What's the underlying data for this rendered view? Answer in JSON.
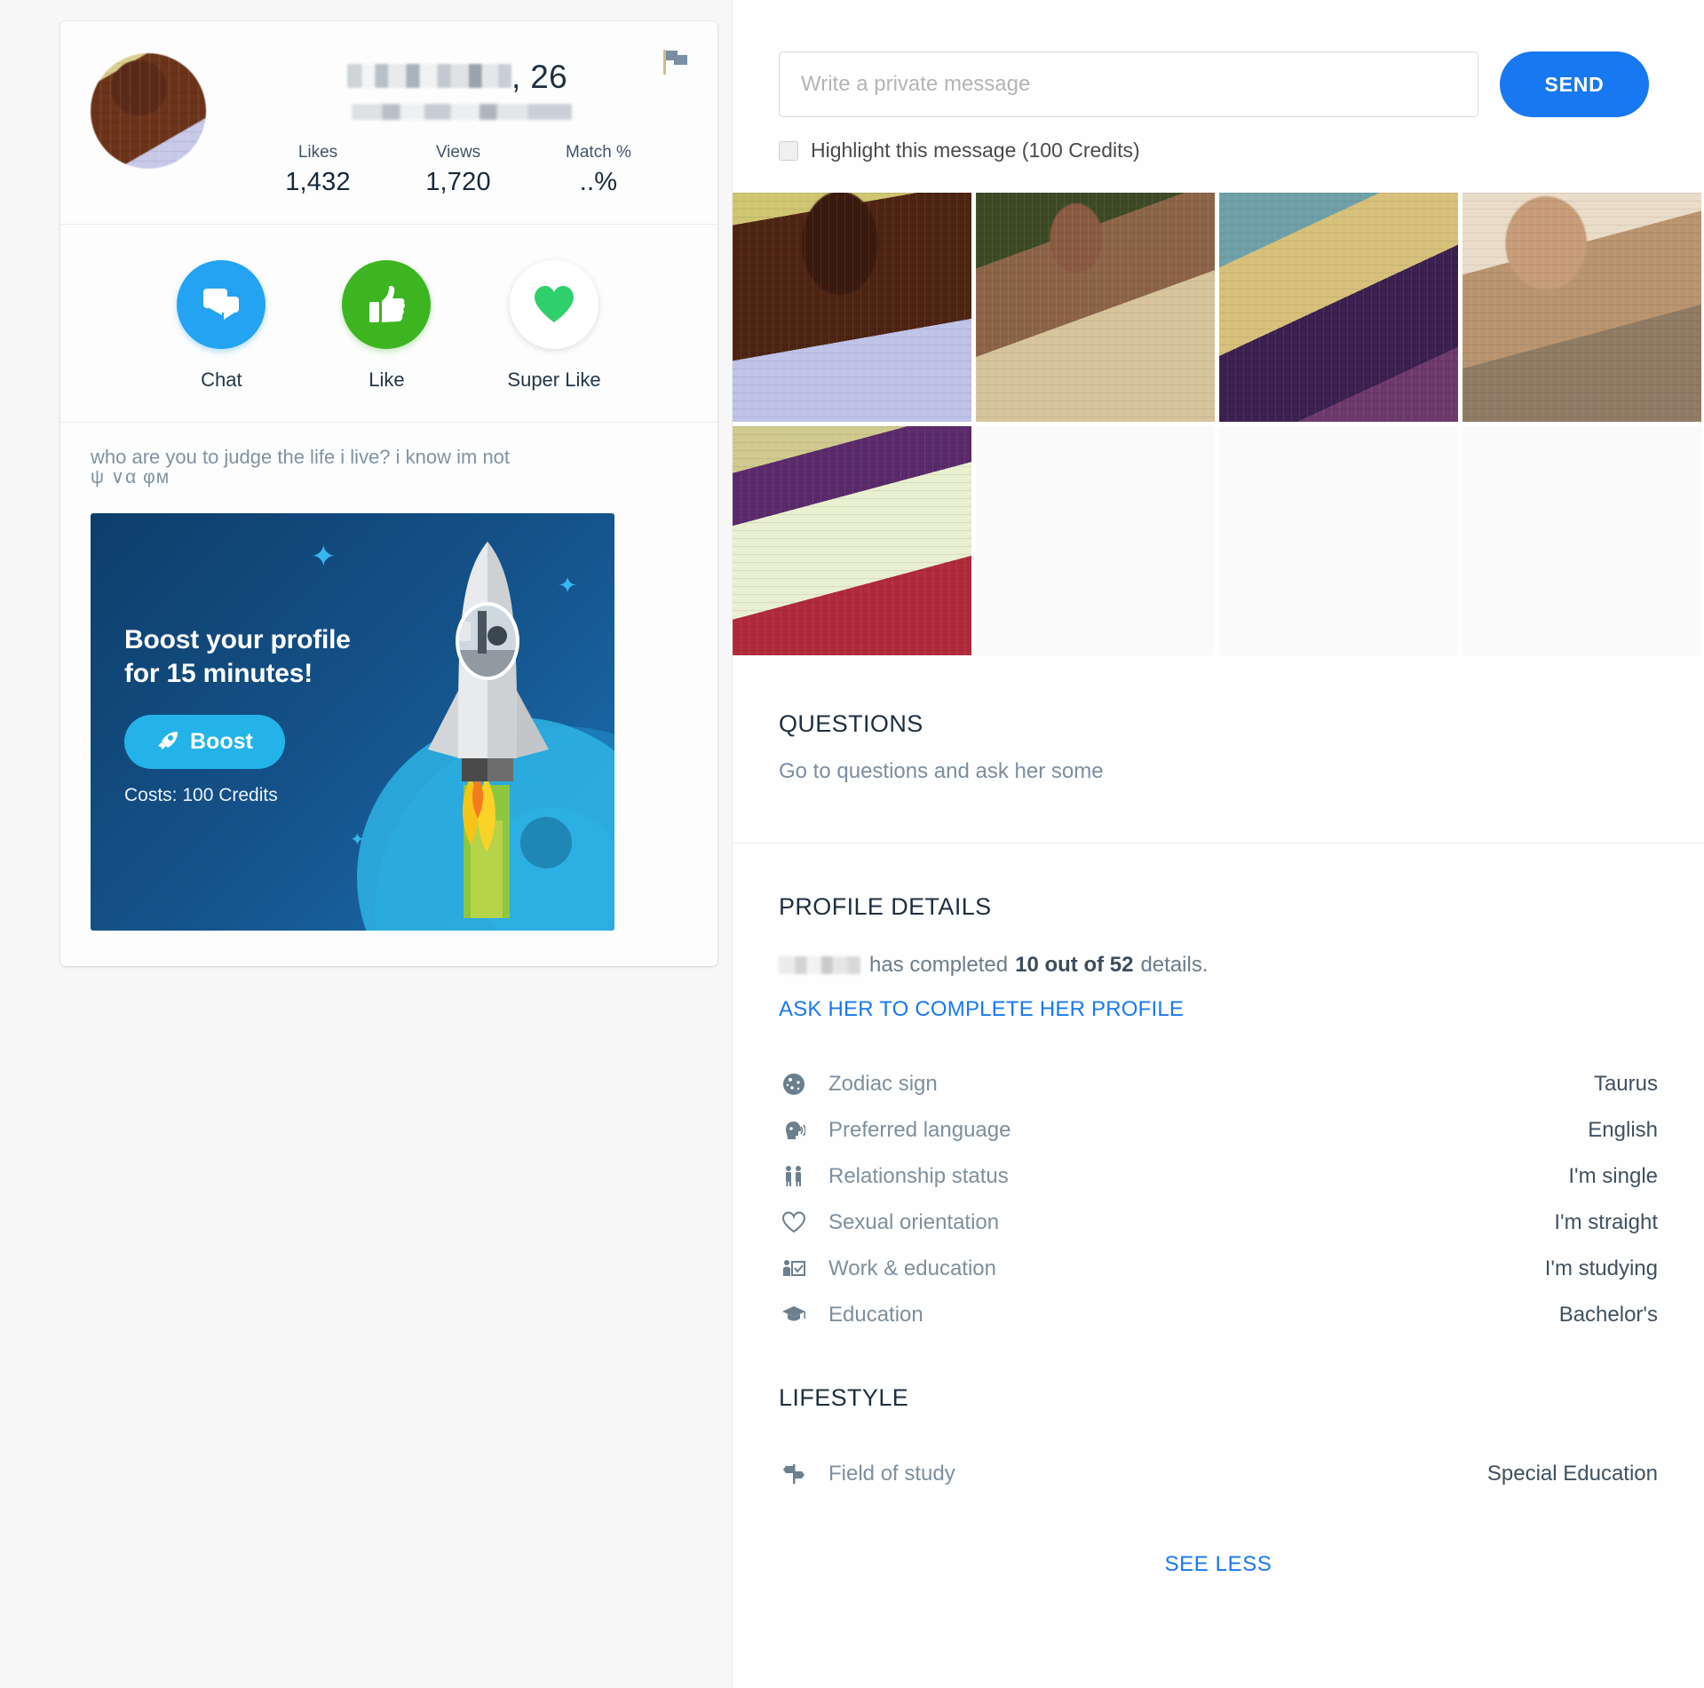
{
  "profile": {
    "name_redacted": true,
    "age": ", 26",
    "flag_icon": "flag-icon",
    "stats": [
      {
        "label": "Likes",
        "value": "1,432"
      },
      {
        "label": "Views",
        "value": "1,720"
      },
      {
        "label": "Match %",
        "value": "..%"
      }
    ],
    "actions": [
      {
        "label": "Chat",
        "icon": "chat-bubbles-icon",
        "color": "#23a3f2"
      },
      {
        "label": "Like",
        "icon": "thumbs-up-icon",
        "color": "#3cb521"
      },
      {
        "label": "Super Like",
        "icon": "heart-icon",
        "color": "#2fd06b"
      }
    ],
    "bio": "who are you to judge the life i live? i know im not",
    "bio_glyphs": "ψ ∨α φм"
  },
  "boost": {
    "title": "Boost your profile for 15 minutes!",
    "button_label": "Boost",
    "button_icon": "rocket-icon",
    "cost": "Costs: 100 Credits"
  },
  "message": {
    "placeholder": "Write a private message",
    "value": "",
    "send_label": "SEND",
    "highlight_label": "Highlight this message (100 Credits)",
    "highlight_checked": false
  },
  "gallery": {
    "photos": [
      {
        "name": "photo-1",
        "filled": true
      },
      {
        "name": "photo-2",
        "filled": true
      },
      {
        "name": "photo-3",
        "filled": true
      },
      {
        "name": "photo-4",
        "filled": true
      },
      {
        "name": "photo-5",
        "filled": true
      },
      {
        "name": "photo-slot-6",
        "filled": false
      },
      {
        "name": "photo-slot-7",
        "filled": false
      },
      {
        "name": "photo-slot-8",
        "filled": false
      }
    ]
  },
  "questions": {
    "title": "QUESTIONS",
    "subtitle": "Go to questions and ask her some"
  },
  "profile_details": {
    "title": "PROFILE DETAILS",
    "completed_prefix": "has completed",
    "completed_count": "10 out of 52",
    "completed_suffix": "details.",
    "ask_link": "ASK HER TO COMPLETE HER PROFILE",
    "rows": [
      {
        "icon": "zodiac-icon",
        "label": "Zodiac sign",
        "value": "Taurus"
      },
      {
        "icon": "speaking-head-icon",
        "label": "Preferred language",
        "value": "English"
      },
      {
        "icon": "two-people-icon",
        "label": "Relationship status",
        "value": "I'm single"
      },
      {
        "icon": "heart-outline-icon",
        "label": "Sexual orientation",
        "value": "I'm straight"
      },
      {
        "icon": "presenter-icon",
        "label": "Work & education",
        "value": "I'm studying"
      },
      {
        "icon": "graduation-cap-icon",
        "label": "Education",
        "value": "Bachelor's"
      }
    ]
  },
  "lifestyle": {
    "title": "LIFESTYLE",
    "rows": [
      {
        "icon": "signpost-icon",
        "label": "Field of study",
        "value": "Special Education"
      }
    ]
  },
  "see_less_label": "SEE LESS",
  "colors": {
    "accent_blue": "#1878f2",
    "chat_blue": "#23a3f2",
    "like_green": "#3cb521",
    "super_green": "#2fd06b",
    "boost_cyan": "#24b3e8"
  }
}
